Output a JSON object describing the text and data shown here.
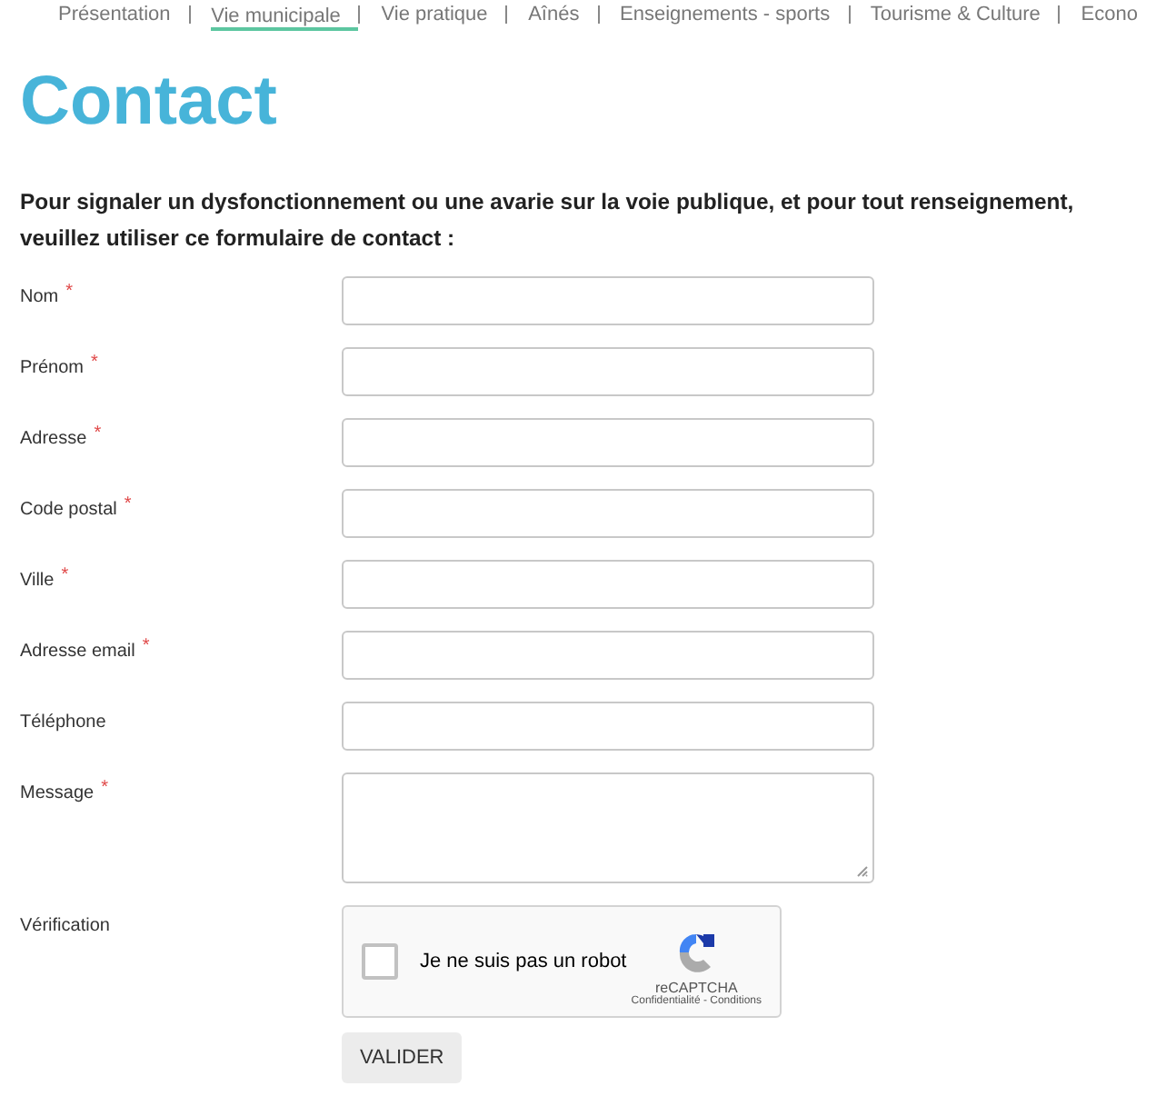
{
  "nav": [
    {
      "label": "Présentation",
      "selected": false
    },
    {
      "label": "Vie municipale",
      "selected": true
    },
    {
      "label": "Vie pratique",
      "selected": false
    },
    {
      "label": "Aînés",
      "selected": false
    },
    {
      "label": "Enseignements - sports",
      "selected": false
    },
    {
      "label": "Tourisme & Culture",
      "selected": false
    },
    {
      "label": "Econo",
      "selected": false
    }
  ],
  "title": "Contact",
  "intro": "Pour signaler un dysfonctionnement ou une avarie sur la voie publique, et pour tout renseignement, veuillez utiliser ce formulaire de contact :",
  "fields": [
    {
      "label": "Nom",
      "required": true,
      "kind": "input"
    },
    {
      "label": "Prénom",
      "required": true,
      "kind": "input"
    },
    {
      "label": "Adresse",
      "required": true,
      "kind": "input"
    },
    {
      "label": "Code postal",
      "required": true,
      "kind": "input"
    },
    {
      "label": "Ville",
      "required": true,
      "kind": "input"
    },
    {
      "label": "Adresse email",
      "required": true,
      "kind": "input"
    },
    {
      "label": "Téléphone",
      "required": false,
      "kind": "input"
    },
    {
      "label": "Message",
      "required": true,
      "kind": "textarea"
    }
  ],
  "required_mark": "*",
  "verification": {
    "label": "Vérification",
    "checked": false,
    "text": "Je ne suis pas un robot",
    "brand": "reCAPTCHA",
    "links": "Confidentialité - Conditions"
  },
  "submit": "VALIDER"
}
